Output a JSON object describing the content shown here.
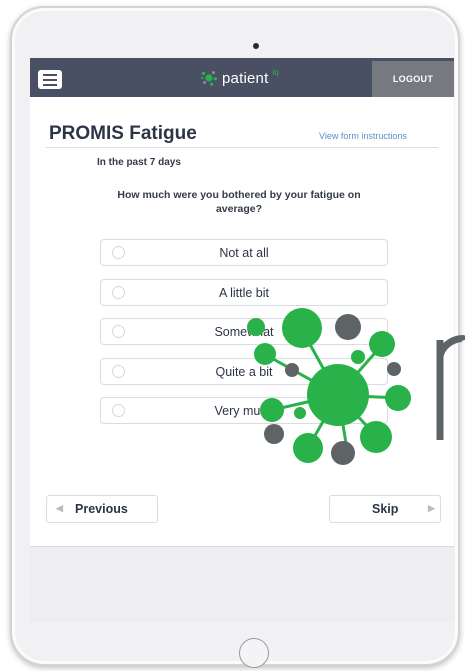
{
  "app": {
    "brand": "patient",
    "brand_sup": "iq",
    "logout_label": "LOGOUT"
  },
  "form": {
    "title": "PROMIS Fatigue",
    "instructions_link": "View form instructions",
    "timeframe": "In the past 7 days",
    "question": "How much were you bothered by your fatigue on average?",
    "options": [
      {
        "label": "Not at all",
        "selected": false
      },
      {
        "label": "A little bit",
        "selected": false
      },
      {
        "label": "Somewhat",
        "selected": false
      },
      {
        "label": "Quite a bit",
        "selected": false
      },
      {
        "label": "Very much",
        "selected": false
      }
    ]
  },
  "nav": {
    "previous_label": "Previous",
    "skip_label": "Skip",
    "previous_arrow": "◀",
    "skip_arrow": "▶"
  },
  "colors": {
    "topbar": "#4a5063",
    "accent_green": "#2ab24a",
    "watermark_gray": "#5e6366"
  }
}
